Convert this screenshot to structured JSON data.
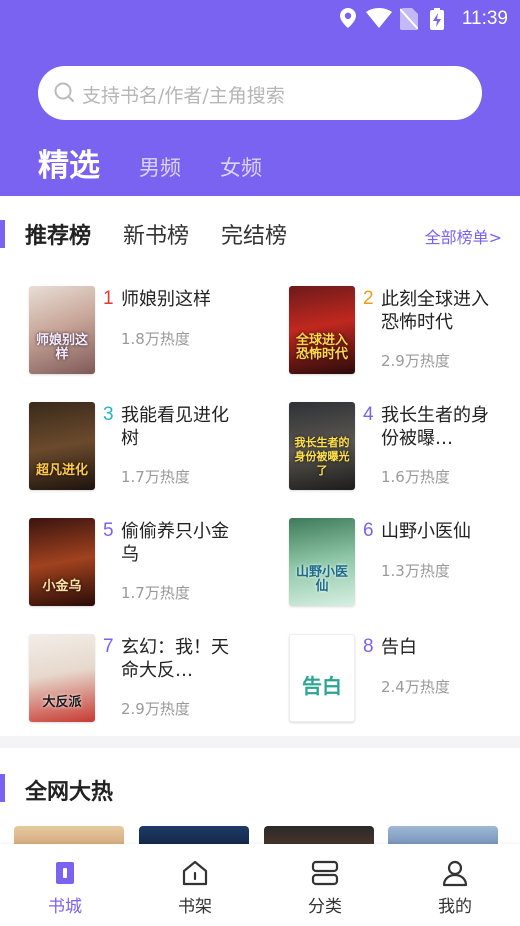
{
  "status_bar": {
    "time": "11:39",
    "icons": [
      "location-icon",
      "wifi-icon",
      "no-sim-icon",
      "battery-charging-icon"
    ]
  },
  "search": {
    "placeholder": "支持书名/作者/主角搜索"
  },
  "top_tabs": [
    {
      "label": "精选",
      "active": true
    },
    {
      "label": "男频",
      "active": false
    },
    {
      "label": "女频",
      "active": false
    }
  ],
  "ranking": {
    "tabs": [
      {
        "label": "推荐榜",
        "active": true
      },
      {
        "label": "新书榜",
        "active": false
      },
      {
        "label": "完结榜",
        "active": false
      }
    ],
    "all_link": "全部榜单>",
    "books": [
      {
        "rank": "1",
        "title": "师娘别这样",
        "heat": "1.8万热度",
        "cover_text": "师娘别这样",
        "rank_color": "#e53935"
      },
      {
        "rank": "2",
        "title": "此刻全球进入恐怖时代",
        "heat": "2.9万热度",
        "cover_text": "全球进入恐怖时代",
        "rank_color": "#f39c12"
      },
      {
        "rank": "3",
        "title": "我能看见进化树",
        "heat": "1.7万热度",
        "cover_text": "超凡进化",
        "rank_color": "#26b5c8"
      },
      {
        "rank": "4",
        "title": "我长生者的身份被曝…",
        "heat": "1.6万热度",
        "cover_text": "我长生者的身份被曝光了",
        "rank_color": "#7a63f0"
      },
      {
        "rank": "5",
        "title": "偷偷养只小金乌",
        "heat": "1.7万热度",
        "cover_text": "小金乌",
        "rank_color": "#7a63f0"
      },
      {
        "rank": "6",
        "title": "山野小医仙",
        "heat": "1.3万热度",
        "cover_text": "山野小医仙",
        "rank_color": "#7a63f0"
      },
      {
        "rank": "7",
        "title": "玄幻：我！天命大反…",
        "heat": "2.9万热度",
        "cover_text": "大反派",
        "rank_color": "#7a63f0"
      },
      {
        "rank": "8",
        "title": "告白",
        "heat": "2.4万热度",
        "cover_text": "告白",
        "rank_color": "#7a63f0"
      }
    ]
  },
  "hot_section": {
    "title": "全网大热"
  },
  "bottom_nav": [
    {
      "label": "书城",
      "icon": "book-city-icon",
      "active": true
    },
    {
      "label": "书架",
      "icon": "bookshelf-icon",
      "active": false
    },
    {
      "label": "分类",
      "icon": "category-icon",
      "active": false
    },
    {
      "label": "我的",
      "icon": "profile-icon",
      "active": false
    }
  ],
  "colors": {
    "accent": "#7a63f0",
    "rank1": "#e53935",
    "rank2": "#f39c12",
    "rank3": "#26b5c8"
  }
}
